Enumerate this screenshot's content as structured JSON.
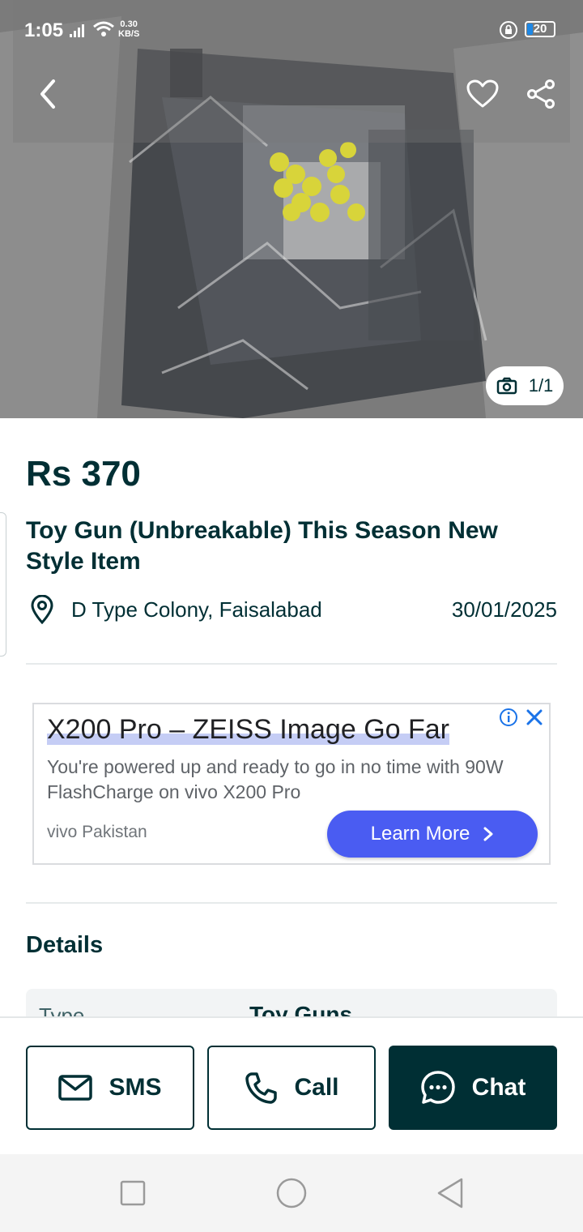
{
  "status_bar": {
    "time": "1:05",
    "speed_value": "0.30",
    "speed_unit": "KB/S",
    "battery": "20"
  },
  "gallery": {
    "photo_counter": "1/1"
  },
  "listing": {
    "price": "Rs 370",
    "title": "Toy  Gun (Unbreakable) This Season New Style Item",
    "location": "D Type Colony, Faisalabad",
    "date": "30/01/2025"
  },
  "ad": {
    "title": "X200 Pro – ZEISS Image Go Far",
    "body": "You're powered up and ready to go in no time with 90W FlashCharge on vivo X200 Pro",
    "brand": "vivo Pakistan",
    "cta": "Learn More"
  },
  "details": {
    "heading": "Details",
    "rows": [
      {
        "key": "Type",
        "value": "Toy Guns"
      }
    ]
  },
  "actions": {
    "sms": "SMS",
    "call": "Call",
    "chat": "Chat"
  },
  "colors": {
    "primary": "#002f34",
    "ad_cta": "#4a5cf2",
    "divider": "#e6eaeb"
  }
}
